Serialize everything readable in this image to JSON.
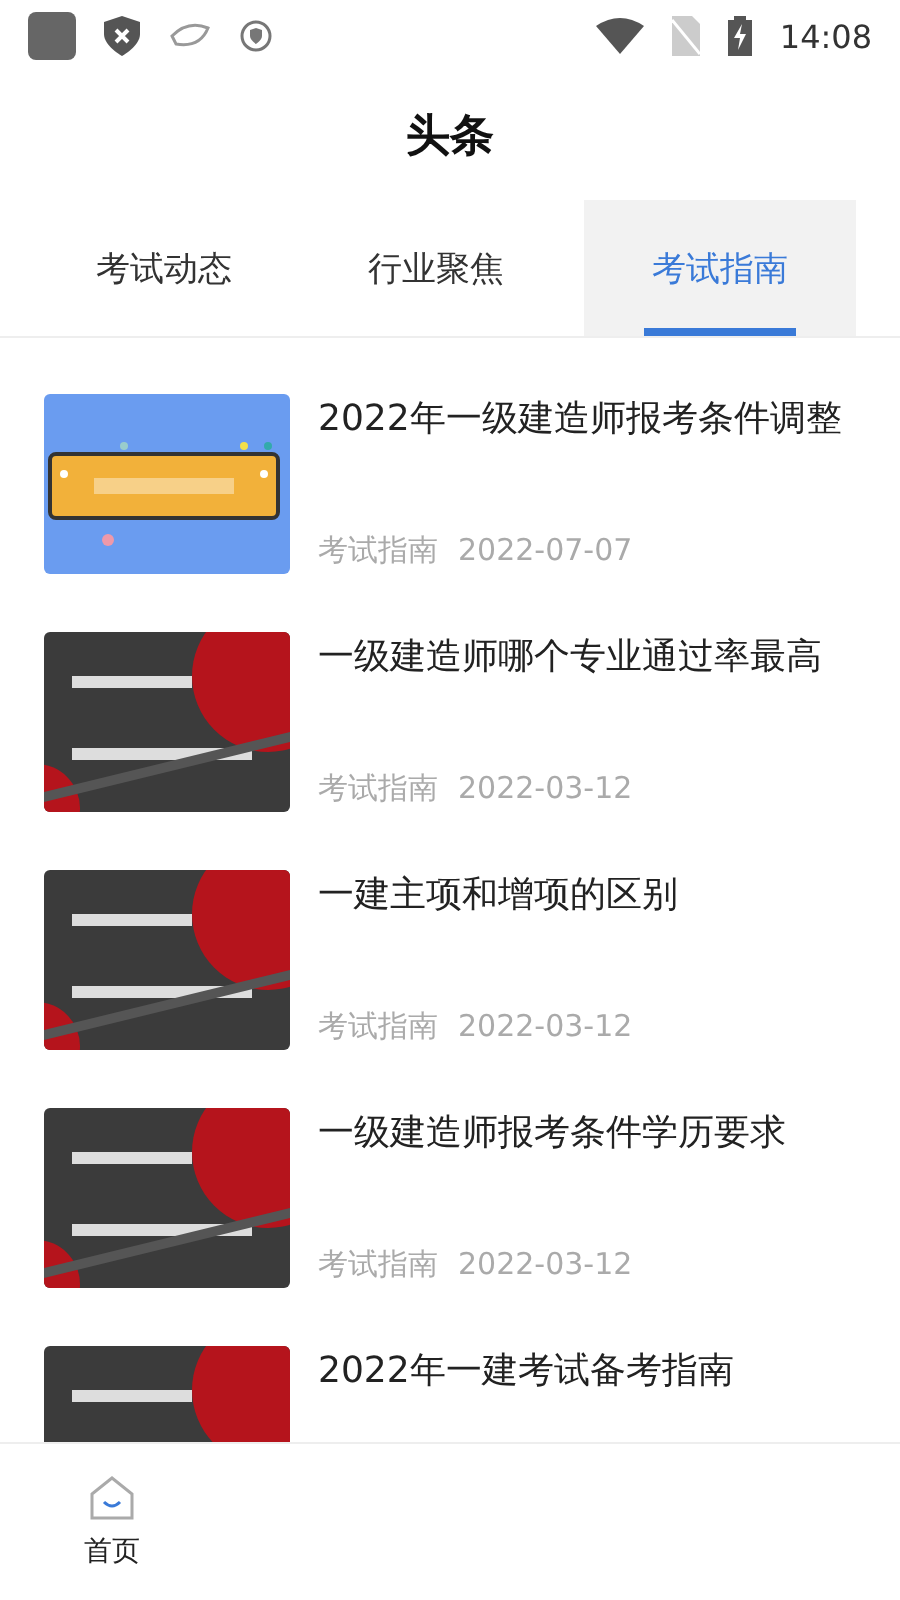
{
  "status_bar": {
    "time": "14:08"
  },
  "header": {
    "title": "头条"
  },
  "tabs": [
    {
      "label": "考试动态",
      "selected": false
    },
    {
      "label": "行业聚焦",
      "selected": false
    },
    {
      "label": "考试指南",
      "selected": true
    }
  ],
  "articles": [
    {
      "kind": "banner",
      "title": "2022年一级建造师报考条件调整",
      "category": "考试指南",
      "date": "2022-07-07"
    },
    {
      "kind": "dark",
      "title": "一级建造师哪个专业通过率最高",
      "category": "考试指南",
      "date": "2022-03-12"
    },
    {
      "kind": "dark",
      "title": "一建主项和增项的区别",
      "category": "考试指南",
      "date": "2022-03-12"
    },
    {
      "kind": "dark",
      "title": "一级建造师报考条件学历要求",
      "category": "考试指南",
      "date": "2022-03-12"
    },
    {
      "kind": "dark",
      "title": "2022年一建考试备考指南"
    }
  ],
  "bottom_nav": [
    {
      "label": "首页",
      "selected": true
    }
  ]
}
